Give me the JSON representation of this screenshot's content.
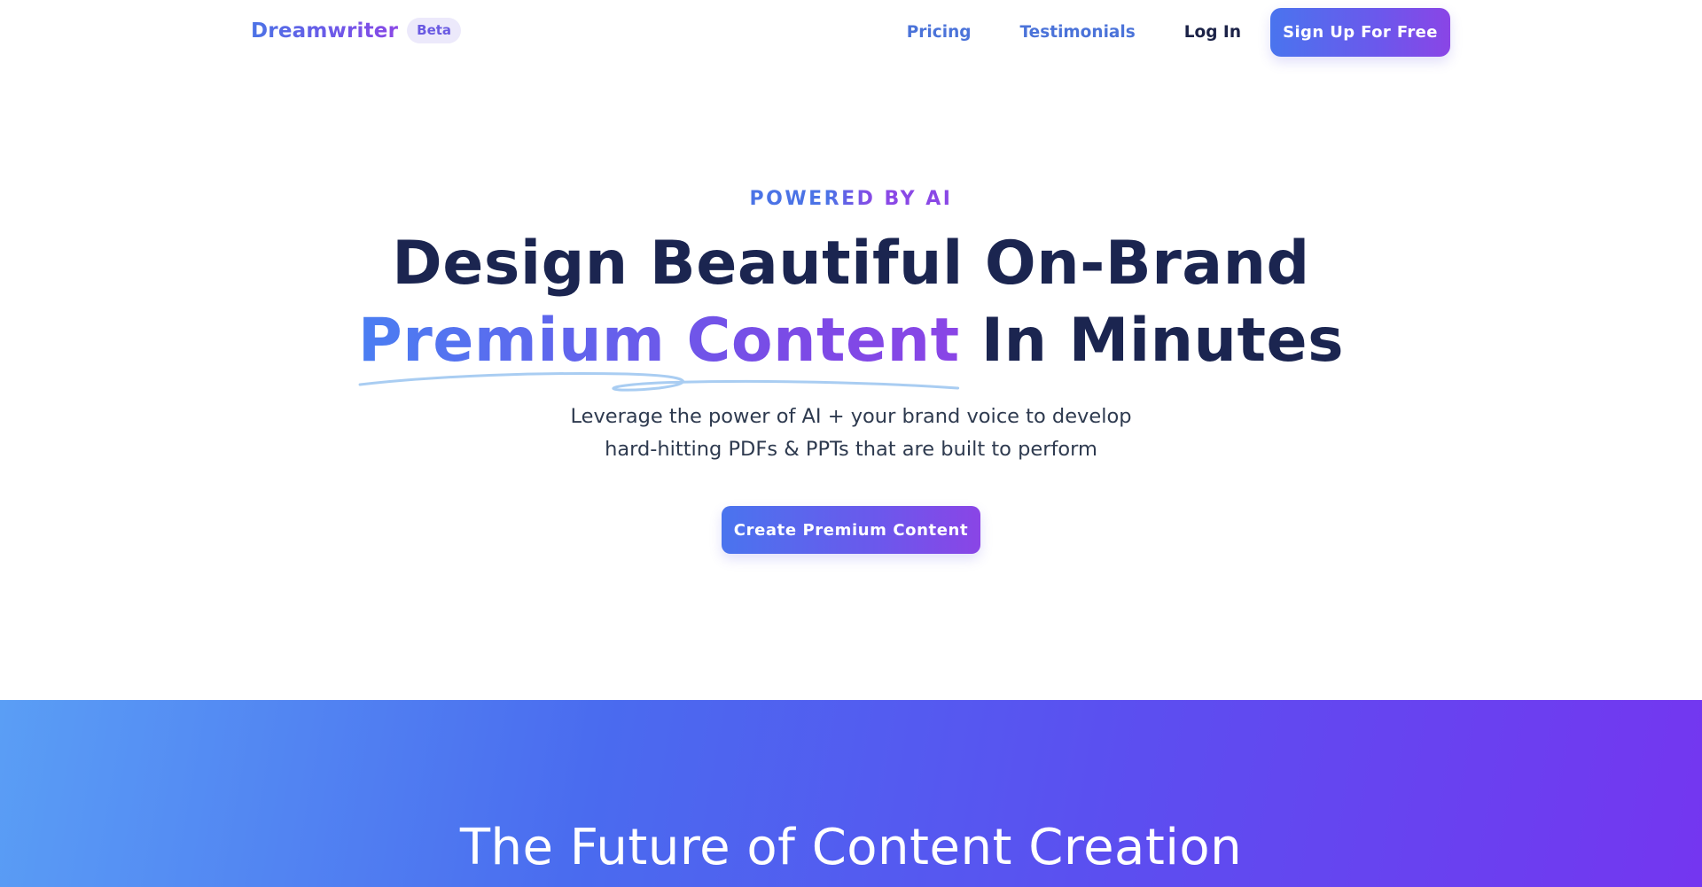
{
  "nav": {
    "brand_name": "Dreamwriter",
    "badge": "Beta",
    "links": {
      "pricing": "Pricing",
      "testimonials": "Testimonials",
      "login": "Log In"
    },
    "signup_label": "Sign Up For Free"
  },
  "hero": {
    "eyebrow": "POWERED BY AI",
    "headline_line1": "Design Beautiful On-Brand",
    "headline_highlight": "Premium Content",
    "headline_line2_rest": " In Minutes",
    "subhead_line1": "Leverage the power of AI + your brand voice to develop",
    "subhead_line2": "hard-hitting PDFs & PPTs that are built to perform",
    "cta_label": "Create Premium Content"
  },
  "section": {
    "title": "The Future of Content Creation"
  },
  "colors": {
    "brand_blue": "#4a74ee",
    "brand_purple": "#8a45e6",
    "headline_navy": "#1b2550",
    "squiggle": "#a9cdf2"
  }
}
